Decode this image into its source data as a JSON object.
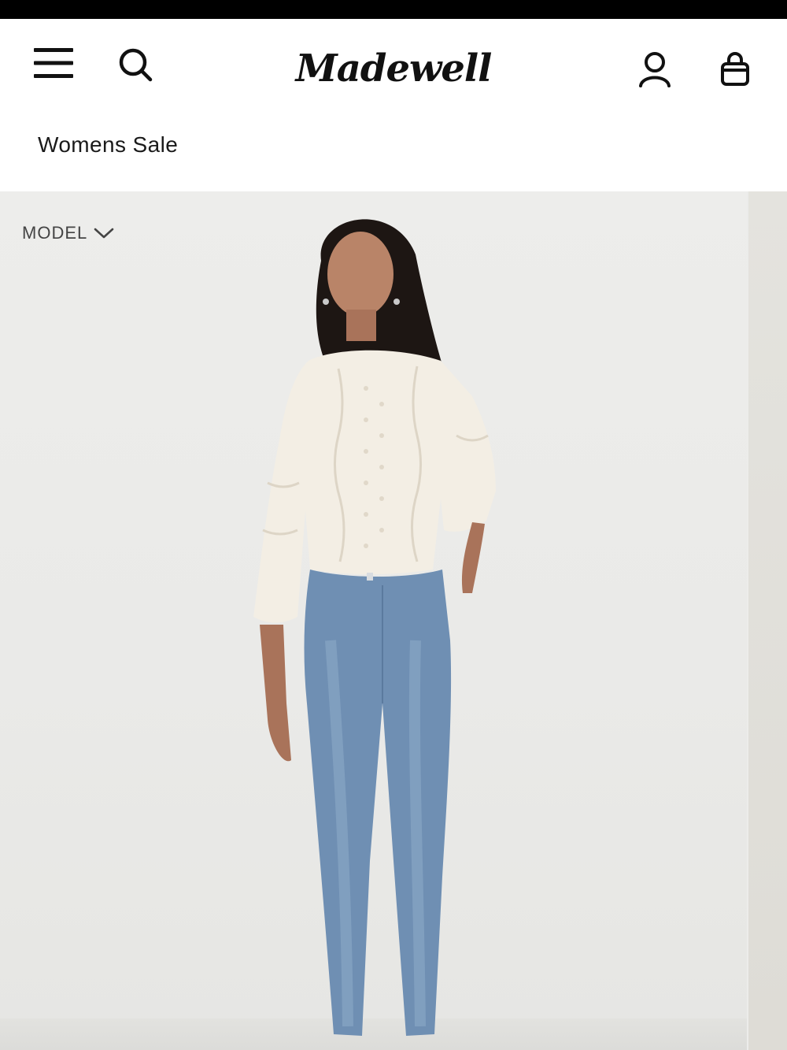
{
  "header": {
    "brand": "Madewell",
    "icons": {
      "menu": "hamburger-menu-icon",
      "search": "search-icon",
      "account": "user-icon",
      "bag": "shopping-bag-icon"
    }
  },
  "breadcrumb": {
    "label": "Womens Sale"
  },
  "gallery": {
    "model_toggle_label": "MODEL"
  },
  "colors": {
    "top_bar": "#000000",
    "background": "#ffffff",
    "photo_background": "#ececea",
    "sweater": "#f3eee4",
    "denim": "#6f8fb3"
  }
}
